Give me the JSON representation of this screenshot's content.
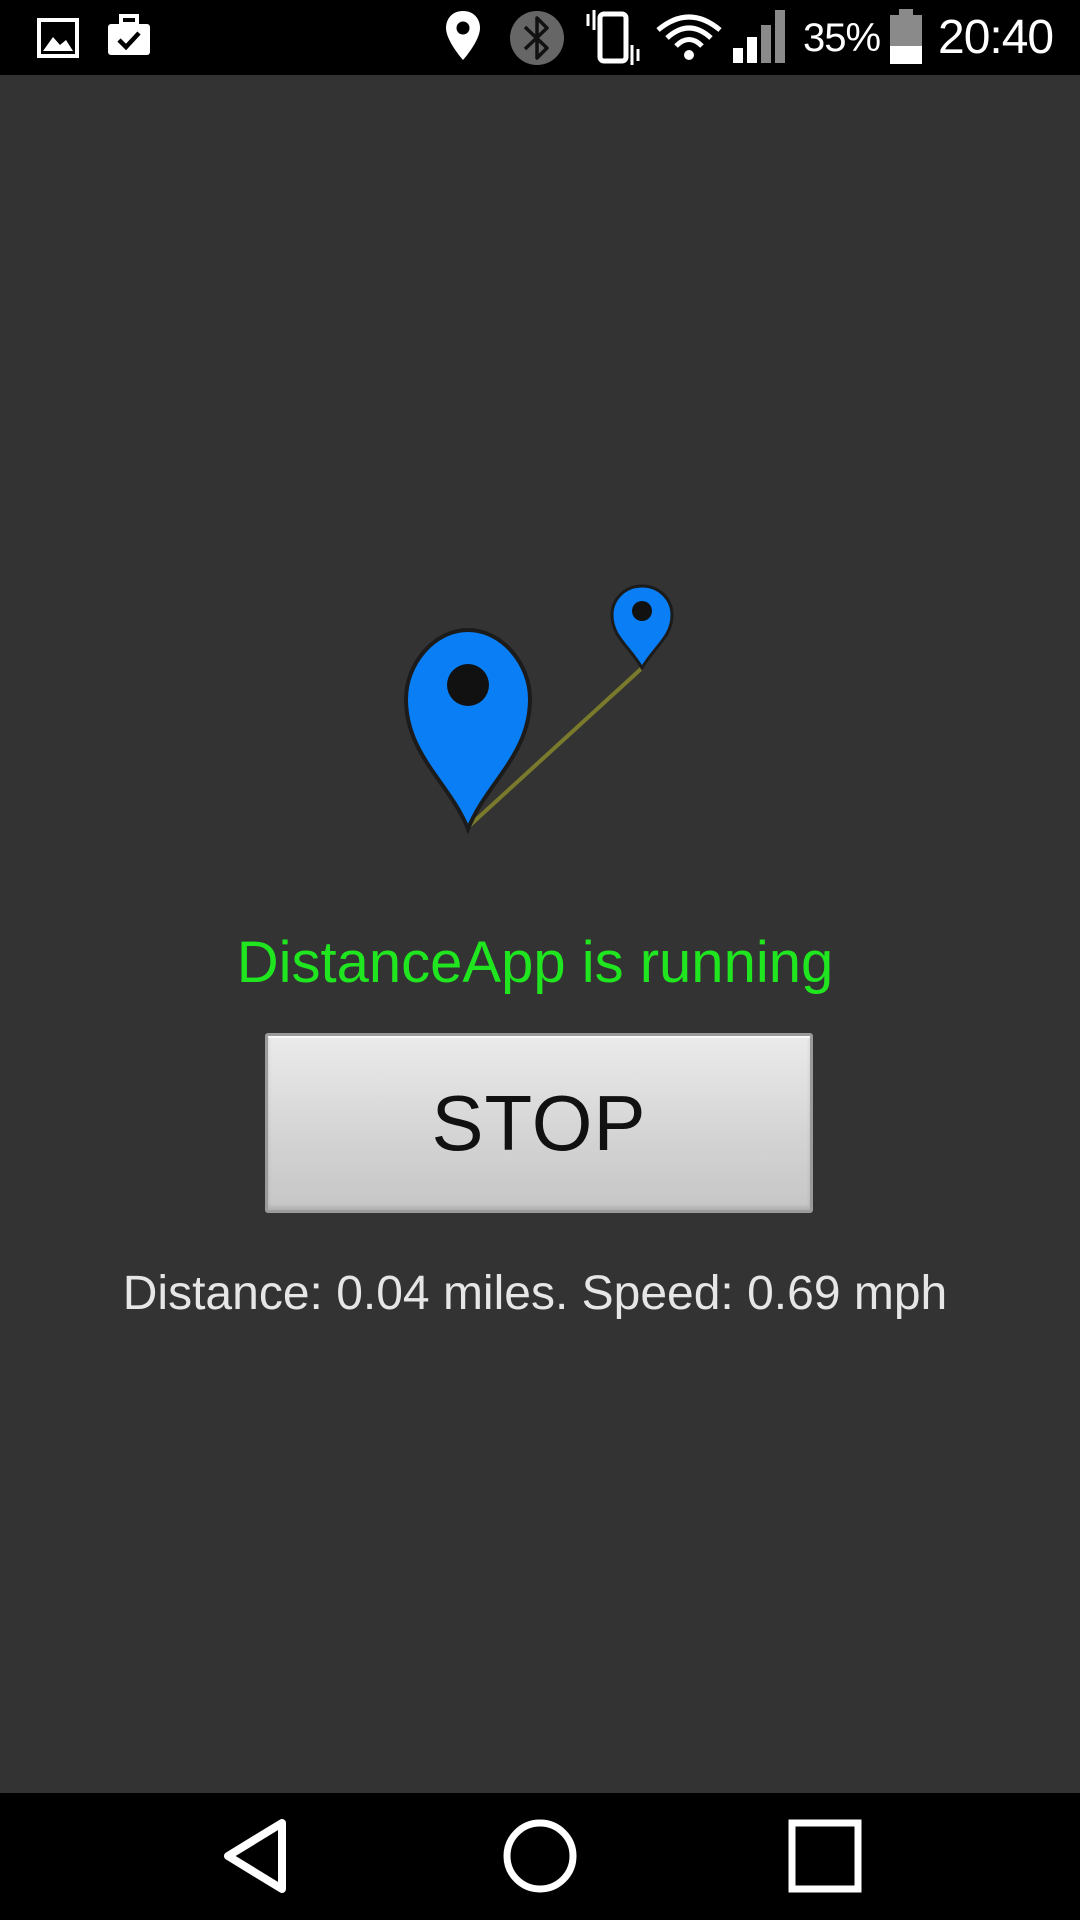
{
  "status_bar": {
    "left_icons": [
      "gallery-icon",
      "briefcase-check-icon"
    ],
    "right_icons": [
      "location-icon",
      "bluetooth-icon",
      "vibrate-icon",
      "wifi-icon",
      "signal-icon",
      "battery-icon"
    ],
    "battery_percent": "35%",
    "time": "20:40"
  },
  "main": {
    "logo_icon": "map-pins-route-icon",
    "status_text": "DistanceApp is running",
    "stop_button_label": "STOP",
    "readout_text": "Distance: 0.04 miles. Speed: 0.69 mph"
  },
  "nav_bar": {
    "buttons": [
      "back-icon",
      "home-icon",
      "recents-icon"
    ]
  },
  "colors": {
    "background": "#333333",
    "status_green": "#1fe61f",
    "pin_blue": "#0a7ff5",
    "bar_black": "#000000"
  }
}
